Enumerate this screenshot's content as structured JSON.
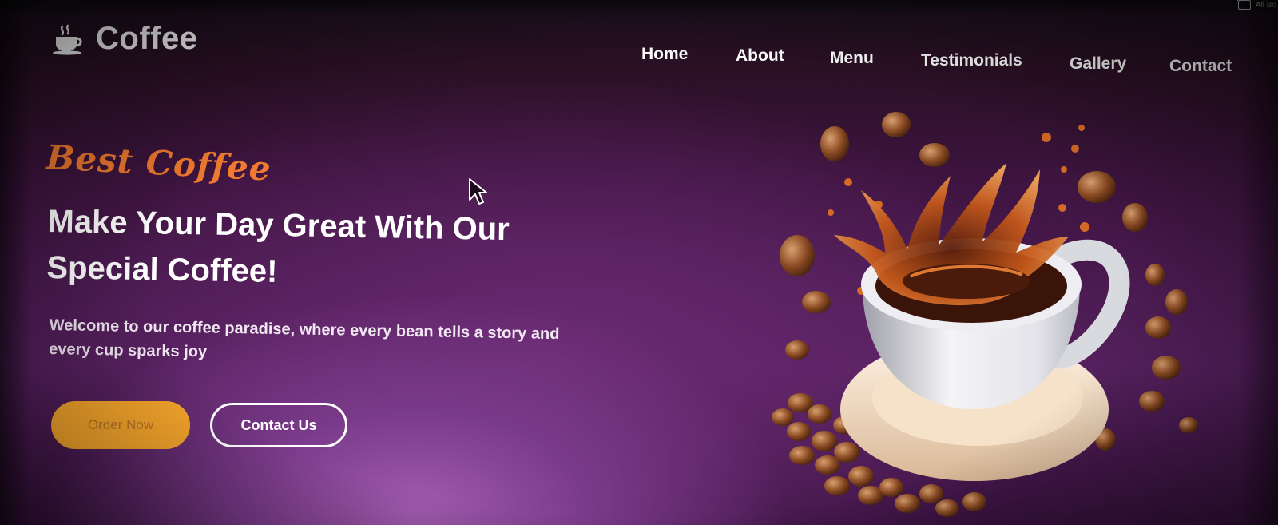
{
  "browser": {
    "bookmarks_label": "All Bo",
    "folder_icon": "folder-icon"
  },
  "brand": {
    "name": "Coffee",
    "icon": "coffee-cup-icon"
  },
  "nav": {
    "items": [
      {
        "label": "Home"
      },
      {
        "label": "About"
      },
      {
        "label": "Menu"
      },
      {
        "label": "Testimonials"
      },
      {
        "label": "Gallery"
      },
      {
        "label": "Contact"
      }
    ]
  },
  "hero": {
    "tagline": "Best Coffee",
    "headline": "Make Your Day Great With Our Special Coffee!",
    "subtext": "Welcome to our coffee paradise, where every bean tells a story and every cup sparks joy",
    "order_button": "Order Now",
    "contact_button": "Contact Us",
    "image": "coffee-cup-splash-illustration"
  },
  "colors": {
    "accent_orange": "#f07a2f",
    "button_amber": "#f5a52b",
    "background_purple": "#55205e",
    "text_white": "#ffffff"
  }
}
